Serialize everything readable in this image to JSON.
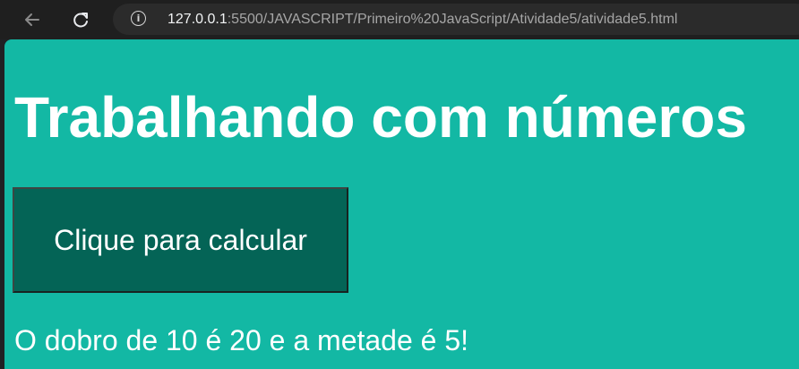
{
  "browser": {
    "address_bar": {
      "url_host": "127.0.0.1",
      "url_rest": ":5500/JAVASCRIPT/Primeiro%20JavaScript/Atividade5/atividade5.html"
    },
    "icons": {
      "back": "arrow-left",
      "reload": "reload",
      "info": "info"
    }
  },
  "page": {
    "background_color": "#13b8a4",
    "title": "Trabalhando com números",
    "button_label": "Clique para calcular",
    "button_color": "#046456",
    "result_text": "O dobro de 10 é 20 e a metade é 5!"
  }
}
